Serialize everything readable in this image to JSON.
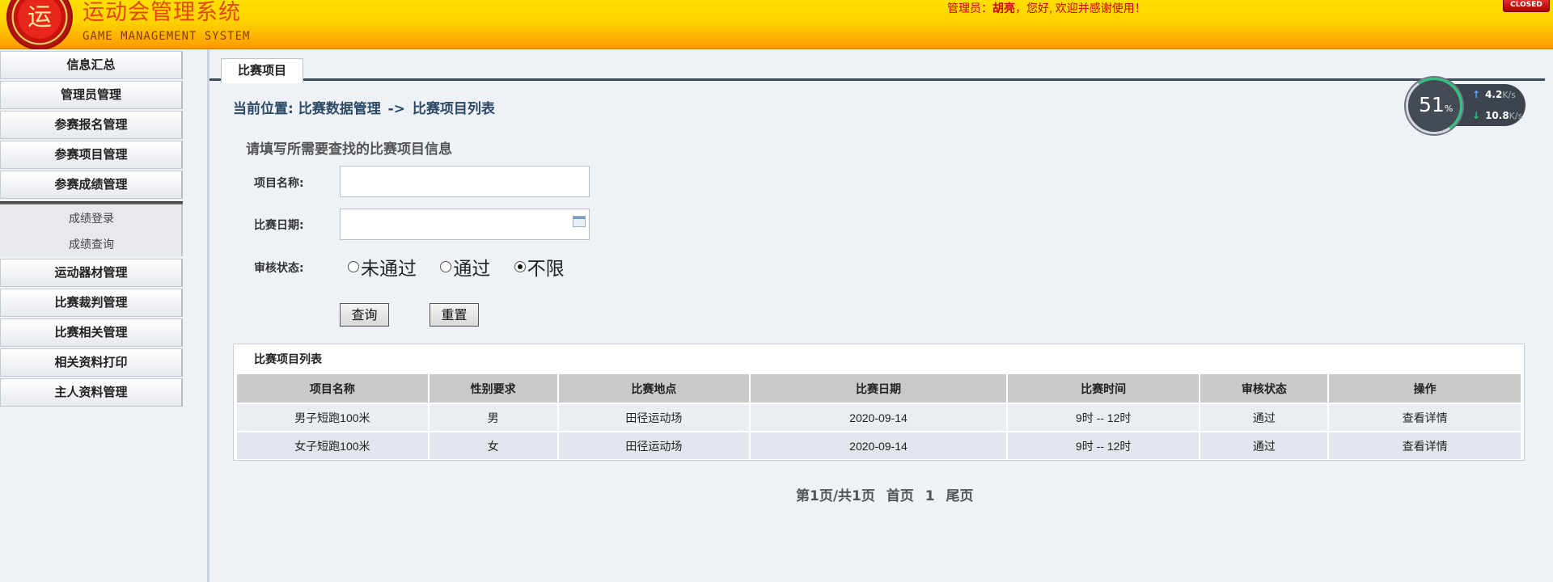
{
  "header": {
    "logo_char": "运",
    "title": "运动会管理系统",
    "subtitle": "GAME MANAGEMENT SYSTEM",
    "welcome_prefix": "管理员：",
    "user_name": "胡亮",
    "welcome_suffix": "，您好, 欢迎并感谢使用！",
    "close_label": "CLOSED"
  },
  "sidebar": {
    "items": [
      {
        "label": "信息汇总"
      },
      {
        "label": "管理员管理"
      },
      {
        "label": "参赛报名管理"
      },
      {
        "label": "参赛项目管理"
      },
      {
        "label": "参赛成绩管理"
      },
      {
        "label": "运动器材管理"
      },
      {
        "label": "比赛裁判管理"
      },
      {
        "label": "比赛相关管理"
      },
      {
        "label": "相关资料打印"
      },
      {
        "label": "主人资料管理"
      }
    ],
    "subitems": [
      {
        "label": "成绩登录"
      },
      {
        "label": "成绩查询"
      }
    ]
  },
  "main": {
    "tab_label": "比赛项目",
    "breadcrumb": {
      "prefix": "当前位置:",
      "parent": "比赛数据管理",
      "arrow": "->",
      "current": "比赛项目列表"
    },
    "search": {
      "title": "请填写所需要查找的比赛项目信息",
      "name_label": "项目名称:",
      "name_value": "",
      "date_label": "比赛日期:",
      "date_value": "",
      "status_label": "审核状态:",
      "status_options": [
        {
          "label": "未通过",
          "checked": false
        },
        {
          "label": "通过",
          "checked": false
        },
        {
          "label": "不限",
          "checked": true
        }
      ],
      "query_button": "查询",
      "reset_button": "重置"
    },
    "table": {
      "caption": "比赛项目列表",
      "columns": [
        "项目名称",
        "性别要求",
        "比赛地点",
        "比赛日期",
        "比赛时间",
        "审核状态",
        "操作"
      ],
      "rows": [
        [
          "男子短跑100米",
          "男",
          "田径运动场",
          "2020-09-14",
          "9时 -- 12时",
          "通过",
          "查看详情"
        ],
        [
          "女子短跑100米",
          "女",
          "田径运动场",
          "2020-09-14",
          "9时 -- 12时",
          "通过",
          "查看详情"
        ]
      ]
    },
    "pager": {
      "summary": "第1页/共1页",
      "first": "首页",
      "page": "1",
      "last": "尾页"
    }
  },
  "speed_widget": {
    "percent": "51",
    "percent_unit": "%",
    "upload": "4.2",
    "download": "10.8",
    "unit": "K/s"
  }
}
